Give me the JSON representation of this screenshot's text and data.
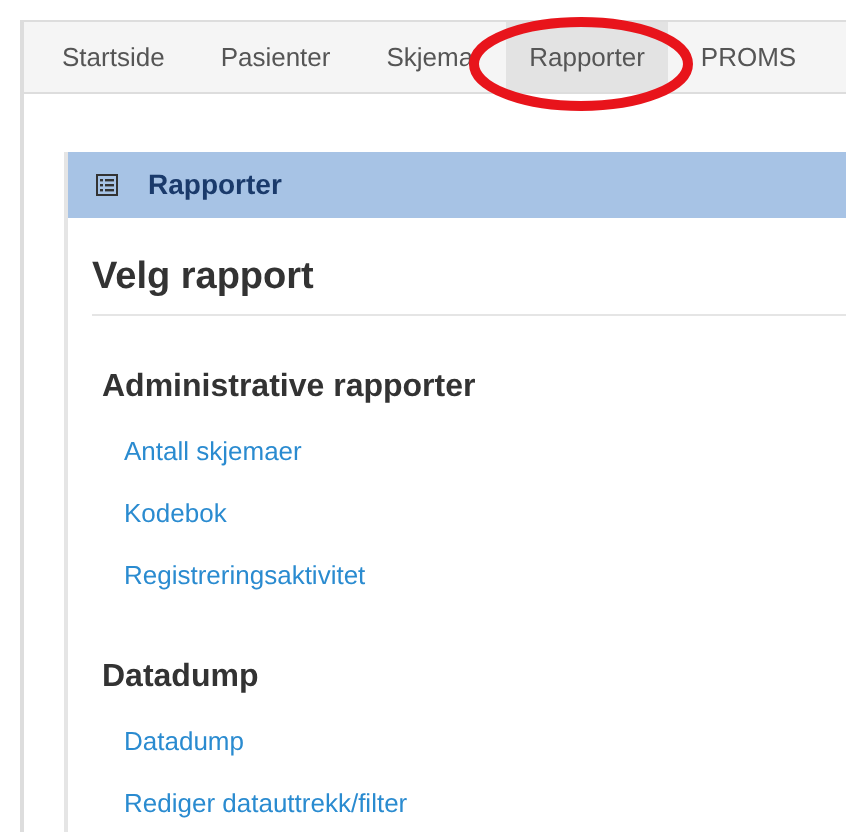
{
  "tabs": [
    {
      "label": "Startside",
      "selected": false
    },
    {
      "label": "Pasienter",
      "selected": false
    },
    {
      "label": "Skjema",
      "selected": false
    },
    {
      "label": "Rapporter",
      "selected": true
    },
    {
      "label": "PROMS",
      "selected": false
    }
  ],
  "panel": {
    "title": "Rapporter",
    "heading": "Velg rapport",
    "sections": [
      {
        "title": "Administrative rapporter",
        "links": [
          "Antall skjemaer",
          "Kodebok",
          "Registreringsaktivitet"
        ]
      },
      {
        "title": "Datadump",
        "links": [
          "Datadump",
          "Rediger datauttrekk/filter"
        ]
      }
    ]
  }
}
